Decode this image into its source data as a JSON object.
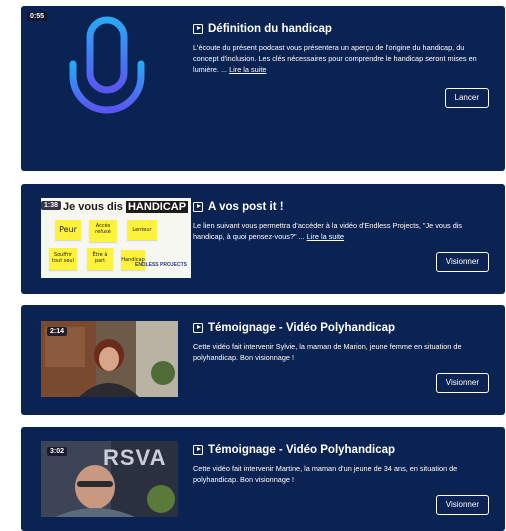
{
  "cards": [
    {
      "duration": "0:55",
      "title": "Définition du handicap",
      "description": "L'écoute du présent podcast vous présentera un aperçu de l'origine du handicap, du concept d'inclusion. Les clés nécessaires pour comprendre le handicap seront mises en lumière. ...",
      "more_link": "Lire la suite",
      "button": "Lancer",
      "icon": "microphone-icon"
    },
    {
      "duration": "1:38",
      "title": "A vos post it !",
      "description": "Le lien suivant vous permettra d'accéder à la vidéo d'Endless Projects, \"Je vous dis handicap, à quoi pensez-vous?\" ...",
      "more_link": "Lire la suite",
      "button": "Visionner",
      "thumb": {
        "heading_prefix": "Je vous dis",
        "heading_highlight": "HANDICAP",
        "notes": [
          "Peur",
          "Accès refusé",
          "Lenteur",
          "Souffrir tout seul",
          "Être à part",
          "Handicap"
        ],
        "brand": "ENDLESS PROJECTS"
      }
    },
    {
      "duration": "2:14",
      "title": "Témoignage - Vidéo Polyhandicap",
      "description": "Cette vidéo fait intervenir Sylvie, la maman de Marion, jeune femme en situation de polyhandicap. Bon visionnage !",
      "button": "Visionner"
    },
    {
      "duration": "3:02",
      "title": "Témoignage - Vidéo Polyhandicap",
      "description": "Cette vidéo fait intervenir Martine, la maman d'un jeune de 34 ans, en situation de polyhandicap. Bon visionnage !",
      "button": "Visionner",
      "thumb": {
        "overlay_text": "RSVA"
      }
    }
  ],
  "colors": {
    "card_bg": "#0b2352",
    "accent": "#3a6bff",
    "text": "#ffffff"
  }
}
